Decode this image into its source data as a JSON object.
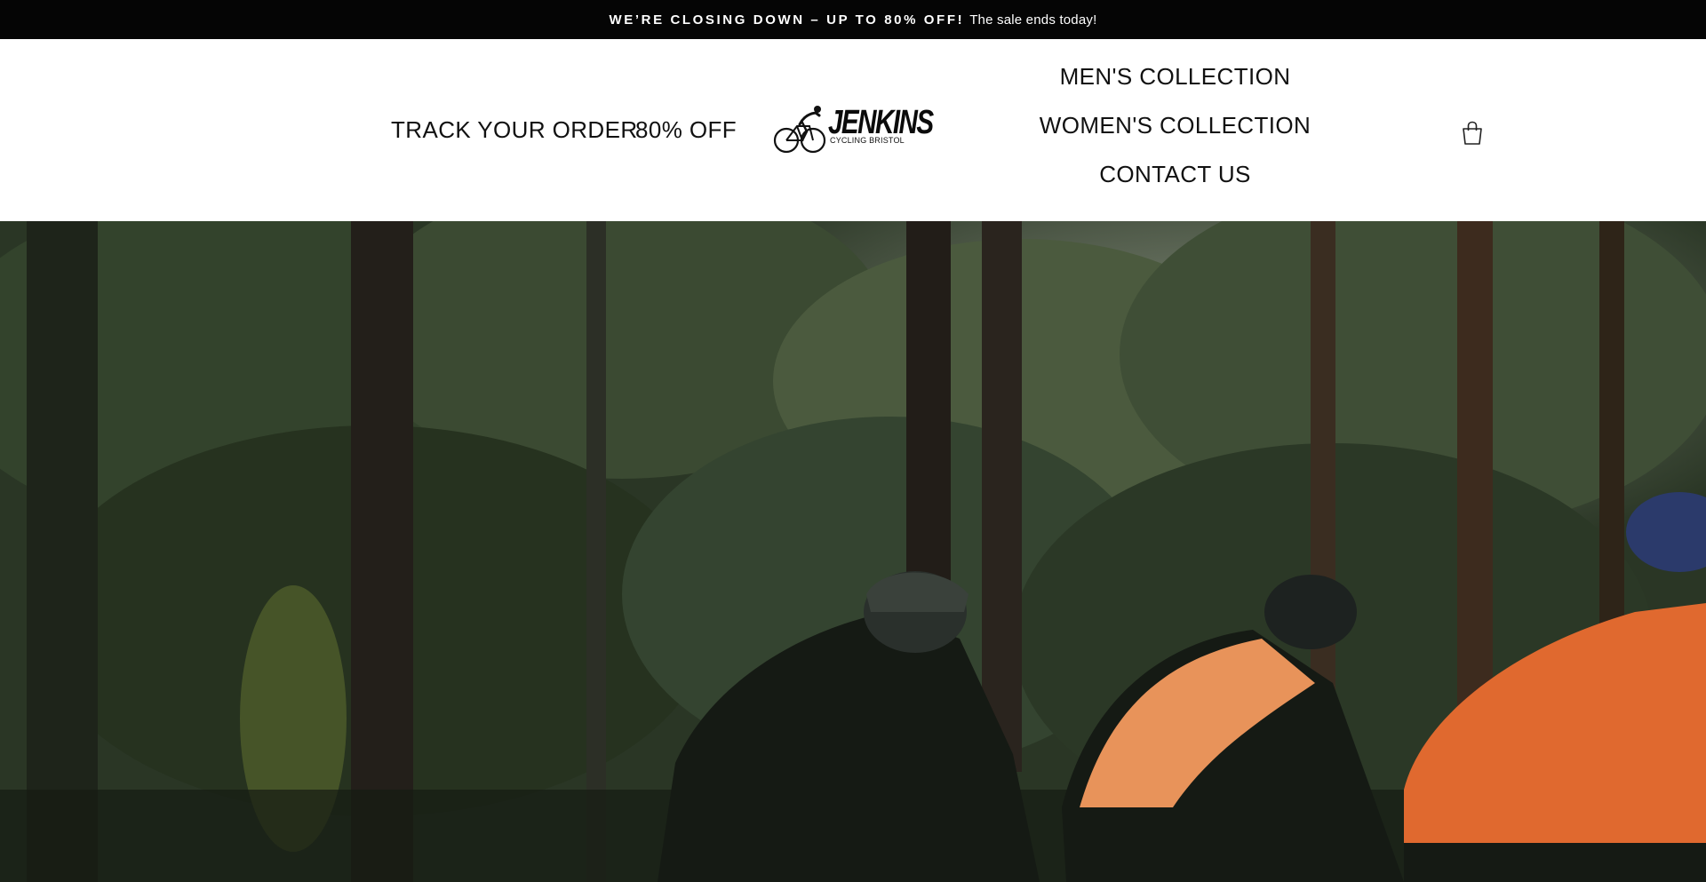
{
  "announcement": {
    "headline": "WE’RE CLOSING DOWN – UP TO 80% OFF!",
    "subtext": "The sale ends today!"
  },
  "nav": {
    "left": [
      {
        "label": "TRACK YOUR ORDER"
      },
      {
        "label": "80% OFF"
      }
    ],
    "right": [
      {
        "label": "MEN'S COLLECTION"
      },
      {
        "label": "WOMEN'S COLLECTION"
      },
      {
        "label": "CONTACT US"
      }
    ]
  },
  "logo": {
    "wordmark": "JENKINS",
    "tagline": "CYCLING BRISTOL",
    "icon": "cyclist-icon"
  },
  "cart": {
    "icon": "shopping-bag-icon"
  },
  "hero": {
    "image": "three cyclists riding through a pine forest",
    "colors": {
      "forest": "#2c3a28",
      "jacket_orange": "#e0692f",
      "vest_orange": "#e8935a",
      "jacket_black": "#151a14"
    }
  },
  "colors": {
    "announcement_bg": "#050505",
    "header_bg": "#ffffff",
    "text": "#111111"
  }
}
